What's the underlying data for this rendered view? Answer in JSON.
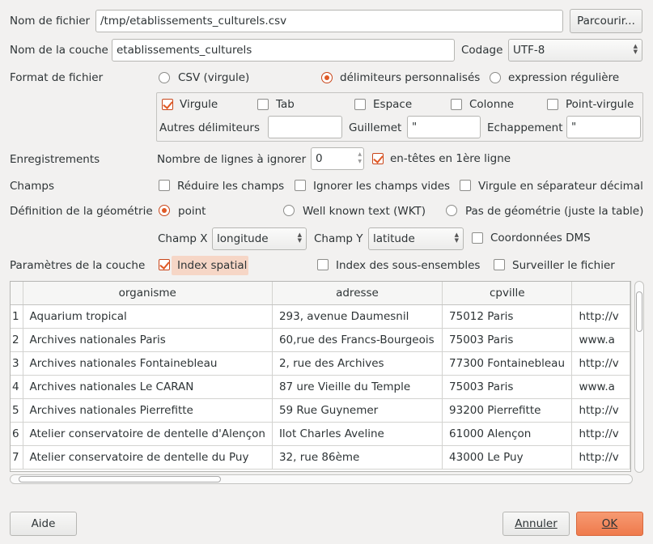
{
  "file": {
    "label": "Nom de fichier",
    "value": "/tmp/etablissements_culturels.csv",
    "browse_label": "Parcourir..."
  },
  "layer": {
    "label": "Nom de la couche",
    "value": "etablissements_culturels",
    "encoding_label": "Codage",
    "encoding_value": "UTF-8"
  },
  "format": {
    "label": "Format de fichier",
    "options": [
      "CSV (virgule)",
      "délimiteurs personnalisés",
      "expression régulière"
    ],
    "selected": "délimiteurs personnalisés"
  },
  "delimiters": {
    "comma": {
      "label": "Virgule",
      "checked": true
    },
    "tab": {
      "label": "Tab",
      "checked": false
    },
    "space": {
      "label": "Espace",
      "checked": false
    },
    "colon": {
      "label": "Colonne",
      "checked": false
    },
    "semicolon": {
      "label": "Point-virgule",
      "checked": false
    },
    "other_label": "Autres délimiteurs",
    "other_value": "",
    "quote_label": "Guillemet",
    "quote_value": "\"",
    "escape_label": "Echappement",
    "escape_value": "\""
  },
  "records": {
    "label": "Enregistrements",
    "skip_label": "Nombre de lignes à ignorer",
    "skip_value": "0",
    "headers_label": "en-têtes en 1ère ligne",
    "headers_checked": true
  },
  "fields": {
    "label": "Champs",
    "trim_label": "Réduire les champs",
    "discard_empty_label": "Ignorer les champs vides",
    "decimal_comma_label": "Virgule en séparateur décimal"
  },
  "geometry": {
    "label": "Définition de la géométrie",
    "point_label": "point",
    "wkt_label": "Well known text (WKT)",
    "none_label": "Pas de géométrie (juste la table)",
    "x_label": "Champ X",
    "x_value": "longitude",
    "y_label": "Champ Y",
    "y_value": "latitude",
    "dms_label": "Coordonnées DMS"
  },
  "layer_settings": {
    "label": "Paramètres de la couche",
    "spatial_index_label": "Index spatial",
    "subset_index_label": "Index des sous-ensembles",
    "watch_file_label": "Surveiller le fichier"
  },
  "table": {
    "columns": [
      "organisme",
      "adresse",
      "cpville",
      ""
    ],
    "rows": [
      [
        "1",
        "Aquarium tropical",
        "293, avenue Daumesnil",
        "75012 Paris",
        "http://v"
      ],
      [
        "2",
        "Archives nationales  Paris",
        "60,rue des Francs-Bourgeois",
        "75003 Paris",
        "www.a"
      ],
      [
        "3",
        "Archives nationales  Fontainebleau",
        "2, rue des Archives",
        "77300 Fontainebleau",
        "http://v"
      ],
      [
        "4",
        "Archives nationales  Le CARAN",
        "87 ure Vieille du Temple",
        "75003 Paris",
        "www.a"
      ],
      [
        "5",
        "Archives nationales  Pierrefitte",
        "59 Rue Guynemer",
        "93200 Pierrefitte",
        "http://v"
      ],
      [
        "6",
        "Atelier conservatoire de dentelle d'Alençon",
        "Ilot Charles Aveline",
        "61000 Alençon",
        "http://v"
      ],
      [
        "7",
        "Atelier conservatoire de dentelle du Puy",
        "32, rue 86ème",
        "43000 Le Puy",
        "http://v"
      ]
    ]
  },
  "buttons": {
    "help": "Aide",
    "cancel": "Annuler",
    "ok": "OK"
  },
  "colors": {
    "accent": "#ef7a4c",
    "window_bg": "#f2f1f0"
  }
}
